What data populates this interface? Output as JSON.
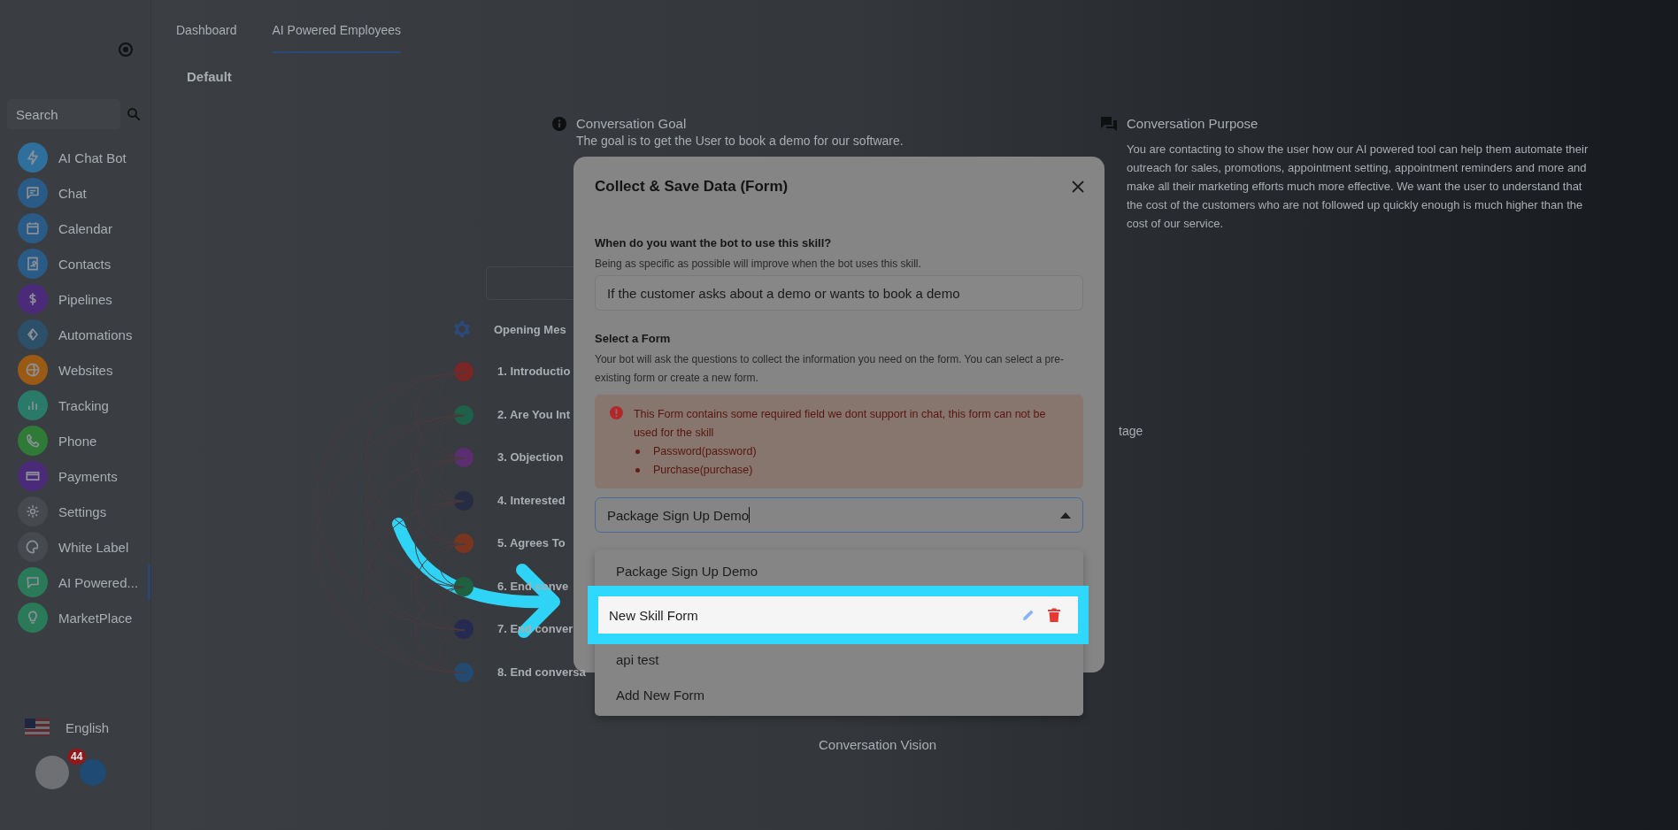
{
  "sidebar": {
    "search": {
      "placeholder": "Search"
    },
    "items": [
      {
        "label": "AI Chat Bot",
        "color": "#2f6f9c",
        "selected": false
      },
      {
        "label": "Chat",
        "color": "#2a5b86",
        "selected": false
      },
      {
        "label": "Calendar",
        "color": "#2a5b86",
        "selected": false
      },
      {
        "label": "Contacts",
        "color": "#2a5b86",
        "selected": false
      },
      {
        "label": "Pipelines",
        "color": "#4b2a7a",
        "selected": false
      },
      {
        "label": "Automations",
        "color": "#2c4f6a",
        "selected": false
      },
      {
        "label": "Websites",
        "color": "#9a5a14",
        "selected": false
      },
      {
        "label": "Tracking",
        "color": "#2a7a6a",
        "selected": false
      },
      {
        "label": "Phone",
        "color": "#2e7a36",
        "selected": false
      },
      {
        "label": "Payments",
        "color": "#4b2a7a",
        "selected": false
      },
      {
        "label": "Settings",
        "color": "#46494d",
        "selected": false
      },
      {
        "label": "White Label",
        "color": "#46494d",
        "selected": false
      },
      {
        "label": "AI Powered...",
        "color": "#2a7a5a",
        "selected": true
      },
      {
        "label": "MarketPlace",
        "color": "#2a7a5a",
        "selected": false
      }
    ],
    "language": "English",
    "notification_badge": "44"
  },
  "tabs": [
    {
      "label": "Dashboard",
      "selected": false
    },
    {
      "label": "AI Powered Employees",
      "selected": true
    }
  ],
  "subtab": "Default",
  "conversation_goal": {
    "title": "Conversation Goal",
    "text": "The goal is to get the User to book a demo for our software."
  },
  "conversation_purpose": {
    "title": "Conversation Purpose",
    "text": "You are contacting to show the user how our AI powered tool can help them automate their outreach for sales, promotions, appointment setting, appointment reminders and more and make all their marketing efforts much more effective. We want the user to understand that the cost of the customers who are not followed up quickly enough is much higher than the cost of our service."
  },
  "steps": {
    "header": "Opening Mes",
    "items": [
      {
        "label": "1. Introductio",
        "color": "#7a2626"
      },
      {
        "label": "2. Are You Int",
        "color": "#1e6048"
      },
      {
        "label": "3. Objection",
        "color": "#5a2e70"
      },
      {
        "label": "4. Interested",
        "color": "#262c44"
      },
      {
        "label": "5. Agrees To",
        "color": "#7a3520"
      },
      {
        "label": "6. End conve",
        "color": "#1e6040"
      },
      {
        "label": "7. End conver",
        "color": "#262a50"
      },
      {
        "label": "8. End conversa",
        "color": "#244a70"
      }
    ]
  },
  "stage_fragment": "tage",
  "conversation_vision": "Conversation Vision",
  "dialog": {
    "title": "Collect & Save Data (Form)",
    "trigger": {
      "label": "When do you want the bot to use this skill?",
      "hint": "Being as specific as possible will improve when the bot uses this skill.",
      "value": "If the customer asks about a demo or wants to book a demo"
    },
    "form": {
      "label": "Select a Form",
      "hint": "Your bot will ask the questions to collect the information you need on the form. You can select a pre-existing form or create a new form.",
      "alert": {
        "text": "This Form contains some required field we dont support in chat, this form can not be used for the skill",
        "items": [
          "Password(password)",
          "Purchase(purchase)"
        ]
      },
      "select": {
        "value": "Package Sign Up Demo",
        "expanded": true
      },
      "options": [
        {
          "label": "Package Sign Up Demo",
          "highlighted": false
        },
        {
          "label": "New Skill Form",
          "highlighted": true
        },
        {
          "label": "api test",
          "highlighted": false
        },
        {
          "label": "Add New Form",
          "highlighted": false
        }
      ]
    }
  }
}
